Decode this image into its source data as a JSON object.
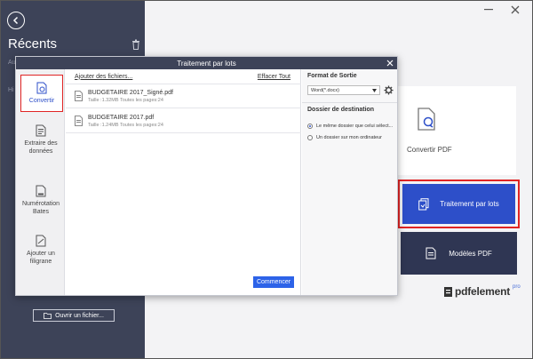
{
  "sidebar": {
    "title": "Récents",
    "ghost_letters": [
      "Au",
      "Hi"
    ],
    "open_file_label": "Ouvrir un fichier..."
  },
  "main": {
    "convert_pdf_label": "Convertir PDF",
    "batch_label": "Traitement par lots",
    "templates_label": "Modèles PDF",
    "brand_name": "pdfelement",
    "brand_pro": "pro"
  },
  "dialog": {
    "title": "Traitement par lots",
    "nav": [
      {
        "label": "Convertir",
        "icon": "convert-icon",
        "active": true
      },
      {
        "label": "Extraire des données",
        "icon": "extract-data-icon"
      },
      {
        "label": "Numérotation Bates",
        "icon": "bates-numbering-icon"
      },
      {
        "label": "Ajouter un filigrane",
        "icon": "watermark-icon"
      }
    ],
    "add_files_label": "Ajouter des fichiers...",
    "clear_all_label": "Effacer Tout",
    "files": [
      {
        "name": "BUDGETAIRE 2017_Signé.pdf",
        "meta": "Taille :1.32MB   Toutes les pages:24"
      },
      {
        "name": "BUDGETAIRE 2017.pdf",
        "meta": "Taille :1.24MB   Toutes les pages:24"
      }
    ],
    "start_label": "Commencer",
    "output_format_title": "Format de Sortie",
    "output_format_value": "Word(*.docx)",
    "destination_title": "Dossier de destination",
    "destination_options": [
      {
        "label": "Le même dossier que celui sélect...",
        "selected": true
      },
      {
        "label": "Un dossier sur mon ordinateur",
        "selected": false
      }
    ]
  },
  "colors": {
    "sidebar_bg": "#3d4358",
    "accent_blue": "#2d4fc9",
    "highlight_red": "#e02424",
    "templates_bg": "#2f3653"
  }
}
